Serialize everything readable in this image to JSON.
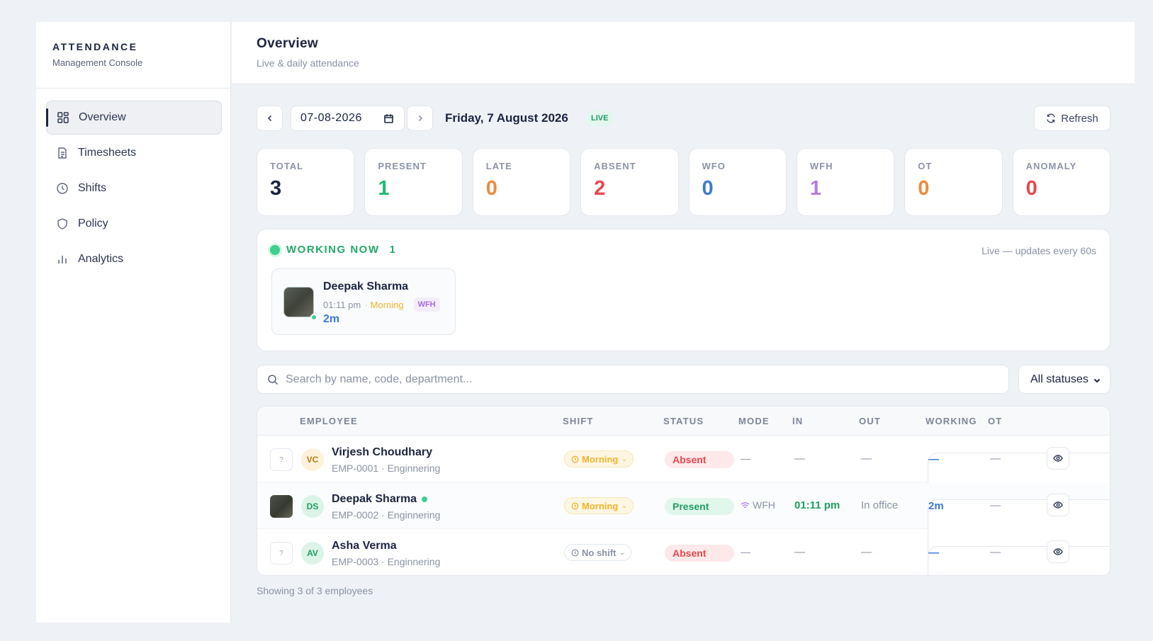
{
  "brand": {
    "title": "ATTENDANCE",
    "subtitle": "Management Console"
  },
  "sidebar": {
    "items": [
      {
        "label": "Overview",
        "icon": "grid-icon",
        "active": true
      },
      {
        "label": "Timesheets",
        "icon": "document-icon"
      },
      {
        "label": "Shifts",
        "icon": "clock-icon"
      },
      {
        "label": "Policy",
        "icon": "shield-icon"
      },
      {
        "label": "Analytics",
        "icon": "bar-chart-icon"
      }
    ]
  },
  "header": {
    "title": "Overview",
    "subtitle": "Live & daily attendance"
  },
  "toolbar": {
    "date_value": "07-08-2026",
    "date_label": "Friday, 7 August 2026",
    "live_badge": "LIVE",
    "refresh_label": "Refresh"
  },
  "stats": [
    {
      "label": "TOTAL",
      "value": "3",
      "color": "#1b2440"
    },
    {
      "label": "PRESENT",
      "value": "1",
      "color": "#22b573"
    },
    {
      "label": "LATE",
      "value": "0",
      "color": "#f08a3c"
    },
    {
      "label": "ABSENT",
      "value": "2",
      "color": "#e5484d"
    },
    {
      "label": "WFO",
      "value": "0",
      "color": "#3a7bd5"
    },
    {
      "label": "WFH",
      "value": "1",
      "color": "#b07ce6"
    },
    {
      "label": "OT",
      "value": "0",
      "color": "#f08a3c"
    },
    {
      "label": "ANOMALY",
      "value": "0",
      "color": "#e5484d"
    }
  ],
  "working_now": {
    "title": "WORKING NOW",
    "count": "1",
    "note": "Live — updates every 60s",
    "card": {
      "name": "Deepak Sharma",
      "time": "01:11 pm",
      "separator": "·",
      "shift": "Morning",
      "mode": "WFH",
      "duration": "2m"
    }
  },
  "search": {
    "placeholder": "Search by name, code, department..."
  },
  "status_filter": {
    "selected": "All statuses"
  },
  "table": {
    "headers": {
      "employee": "EMPLOYEE",
      "shift": "SHIFT",
      "status": "STATUS",
      "mode": "MODE",
      "in": "IN",
      "out": "OUT",
      "working": "WORKING",
      "ot": "OT"
    },
    "rows": [
      {
        "photo": "?",
        "initials": "VC",
        "name": "Virjesh Choudhary",
        "meta": "EMP-0001 · Enginnering",
        "shift": "Morning",
        "status": "Absent",
        "mode": "—",
        "in": "—",
        "out": "—",
        "working": "—",
        "ot": "—"
      },
      {
        "photo": "",
        "initials": "DS",
        "name": "Deepak Sharma",
        "meta": "EMP-0002 · Enginnering",
        "shift": "Morning",
        "status": "Present",
        "mode": "WFH",
        "in": "01:11 pm",
        "out": "In office",
        "working": "2m",
        "ot": "—"
      },
      {
        "photo": "?",
        "initials": "AV",
        "name": "Asha Verma",
        "meta": "EMP-0003 · Enginnering",
        "shift": "No shift",
        "status": "Absent",
        "mode": "—",
        "in": "—",
        "out": "—",
        "working": "—",
        "ot": "—"
      }
    ]
  },
  "footer": {
    "note": "Showing 3 of 3 employees"
  }
}
